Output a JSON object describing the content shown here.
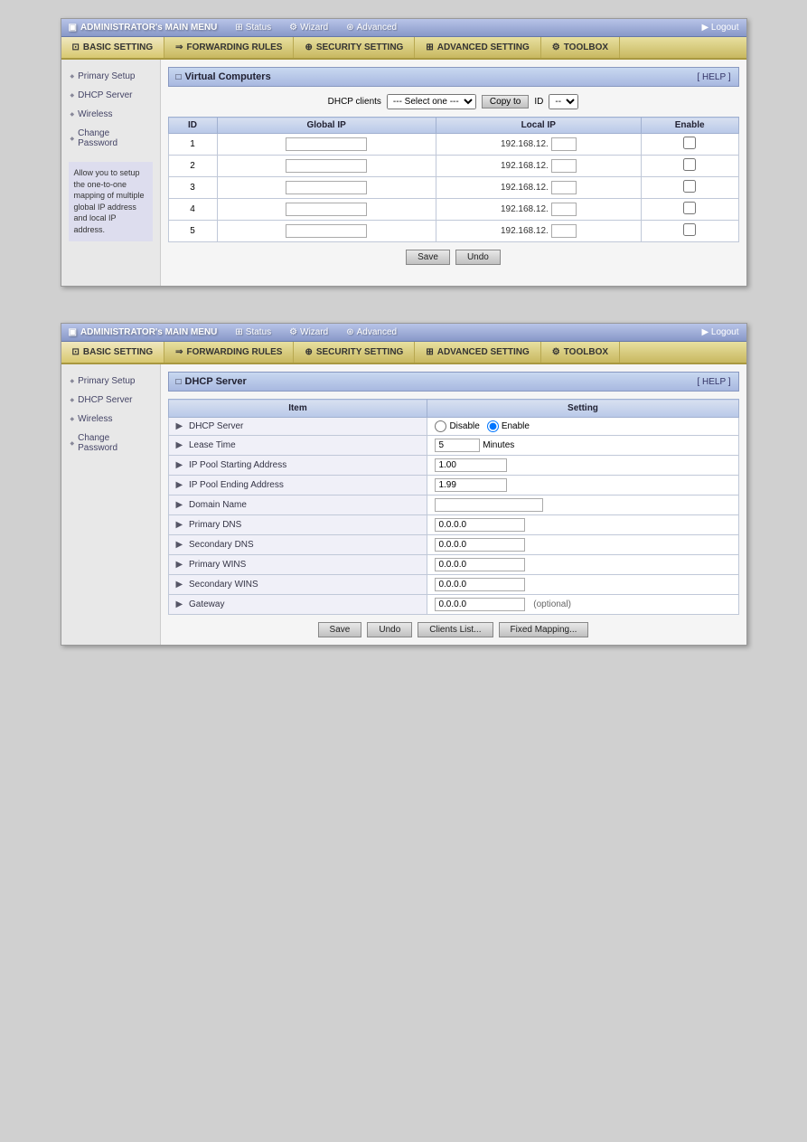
{
  "panels": {
    "panel1": {
      "topnav": {
        "brand": "ADMINISTRATOR's MAIN MENU",
        "items": [
          "Status",
          "Wizard",
          "Advanced"
        ],
        "logout": "Logout"
      },
      "tabs": [
        {
          "label": "BASIC SETTING",
          "active": true
        },
        {
          "label": "FORWARDING RULES",
          "active": false
        },
        {
          "label": "SECURITY SETTING",
          "active": false
        },
        {
          "label": "ADVANCED SETTING",
          "active": false
        },
        {
          "label": "TOOLBOX",
          "active": false
        }
      ],
      "sidebar": {
        "items": [
          "Primary Setup",
          "DHCP Server",
          "Wireless",
          "Change Password"
        ],
        "active": "DHCP Server",
        "description": "Allow you to setup the one-to-one mapping of multiple global IP address and local IP address."
      },
      "section": {
        "title": "Virtual Computers",
        "help": "[ HELP ]"
      },
      "dhcp_row": {
        "label": "DHCP clients",
        "select_placeholder": "--- Select one ---",
        "copy_btn": "Copy to",
        "id_label": "ID",
        "id_select": "--"
      },
      "table": {
        "headers": [
          "ID",
          "Global IP",
          "Local IP",
          "Enable"
        ],
        "rows": [
          {
            "id": 1,
            "global_ip": "",
            "local_ip": "192.168.12.",
            "local_ip_suffix": "",
            "enable": false
          },
          {
            "id": 2,
            "global_ip": "",
            "local_ip": "192.168.12.",
            "local_ip_suffix": "",
            "enable": false
          },
          {
            "id": 3,
            "global_ip": "",
            "local_ip": "192.168.12.",
            "local_ip_suffix": "",
            "enable": false
          },
          {
            "id": 4,
            "global_ip": "",
            "local_ip": "192.168.12.",
            "local_ip_suffix": "",
            "enable": false
          },
          {
            "id": 5,
            "global_ip": "",
            "local_ip": "192.168.12.",
            "local_ip_suffix": "",
            "enable": false
          }
        ]
      },
      "buttons": {
        "save": "Save",
        "undo": "Undo"
      }
    },
    "panel2": {
      "topnav": {
        "brand": "ADMINISTRATOR's MAIN MENU",
        "items": [
          "Status",
          "Wizard",
          "Advanced"
        ],
        "logout": "Logout"
      },
      "tabs": [
        {
          "label": "BASIC SETTING",
          "active": true
        },
        {
          "label": "FORWARDING RULES",
          "active": false
        },
        {
          "label": "SECURITY SETTING",
          "active": false
        },
        {
          "label": "ADVANCED SETTING",
          "active": false
        },
        {
          "label": "TOOLBOX",
          "active": false
        }
      ],
      "sidebar": {
        "items": [
          "Primary Setup",
          "DHCP Server",
          "Wireless",
          "Change Password"
        ],
        "active": "DHCP Server"
      },
      "section": {
        "title": "DHCP Server",
        "help": "[ HELP ]"
      },
      "table": {
        "col_item": "Item",
        "col_setting": "Setting",
        "rows": [
          {
            "item": "DHCP Server",
            "type": "radio",
            "options": [
              "Disable",
              "Enable"
            ],
            "selected": "Enable"
          },
          {
            "item": "Lease Time",
            "type": "text_minutes",
            "value": "5",
            "suffix": "Minutes"
          },
          {
            "item": "IP Pool Starting Address",
            "type": "text",
            "value": "1.00"
          },
          {
            "item": "IP Pool Ending Address",
            "type": "text",
            "value": "1.99"
          },
          {
            "item": "Domain Name",
            "type": "text",
            "value": ""
          },
          {
            "item": "Primary DNS",
            "type": "text",
            "value": "0.0.0.0"
          },
          {
            "item": "Secondary DNS",
            "type": "text",
            "value": "0.0.0.0"
          },
          {
            "item": "Primary WINS",
            "type": "text",
            "value": "0.0.0.0"
          },
          {
            "item": "Secondary WINS",
            "type": "text",
            "value": "0.0.0.0"
          },
          {
            "item": "Gateway",
            "type": "text_optional",
            "value": "0.0.0.0",
            "suffix": "(optional)"
          }
        ]
      },
      "buttons": {
        "save": "Save",
        "undo": "Undo",
        "clients_list": "Clients List...",
        "fixed_mapping": "Fixed Mapping..."
      }
    }
  }
}
